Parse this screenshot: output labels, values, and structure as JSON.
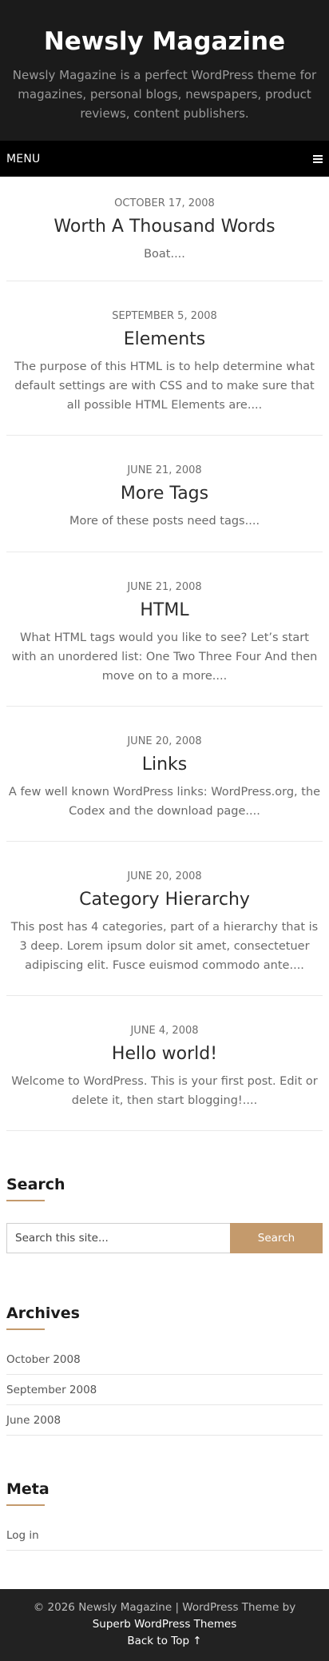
{
  "header": {
    "site_title": "Newsly Magazine",
    "tagline": "Newsly Magazine is a perfect WordPress theme for magazines, personal blogs, newspapers, product reviews, content publishers."
  },
  "nav": {
    "menu_label": "MENU",
    "menu_icon": "hamburger-icon"
  },
  "posts": [
    {
      "date": "OCTOBER 17, 2008",
      "title": "Worth A Thousand Words",
      "excerpt": "Boat...."
    },
    {
      "date": "SEPTEMBER 5, 2008",
      "title": "Elements",
      "excerpt": "The purpose of this HTML is to help determine what default settings are with CSS and to make sure that all possible HTML Elements are...."
    },
    {
      "date": "JUNE 21, 2008",
      "title": "More Tags",
      "excerpt": "More of these posts need tags...."
    },
    {
      "date": "JUNE 21, 2008",
      "title": "HTML",
      "excerpt": "What HTML tags would you like to see? Let’s start with an unordered list: One Two Three Four And then move on to a more...."
    },
    {
      "date": "JUNE 20, 2008",
      "title": "Links",
      "excerpt": "A few well known WordPress links: WordPress.org, the Codex and the download page...."
    },
    {
      "date": "JUNE 20, 2008",
      "title": "Category Hierarchy",
      "excerpt": "This post has 4 categories, part of a hierarchy that is 3 deep. Lorem ipsum dolor sit amet, consectetuer adipiscing elit. Fusce euismod commodo ante...."
    },
    {
      "date": "JUNE 4, 2008",
      "title": "Hello world!",
      "excerpt": "Welcome to WordPress. This is your first post. Edit or delete it, then start blogging!...."
    }
  ],
  "sidebar": {
    "search": {
      "title": "Search",
      "placeholder": "Search this site...",
      "button_label": "Search"
    },
    "archives": {
      "title": "Archives",
      "items": [
        "October 2008",
        "September 2008",
        "June 2008"
      ]
    },
    "meta": {
      "title": "Meta",
      "items": [
        "Log in"
      ]
    }
  },
  "footer": {
    "copyright": "© 2026 Newsly Magazine | WordPress Theme by ",
    "theme_link": "Superb WordPress Themes",
    "back_to_top": "Back to Top ↑"
  },
  "colors": {
    "header_bg": "#1b1b1b",
    "menu_bg": "#000000",
    "accent": "#c49a6c",
    "footer_bg": "#222222"
  }
}
